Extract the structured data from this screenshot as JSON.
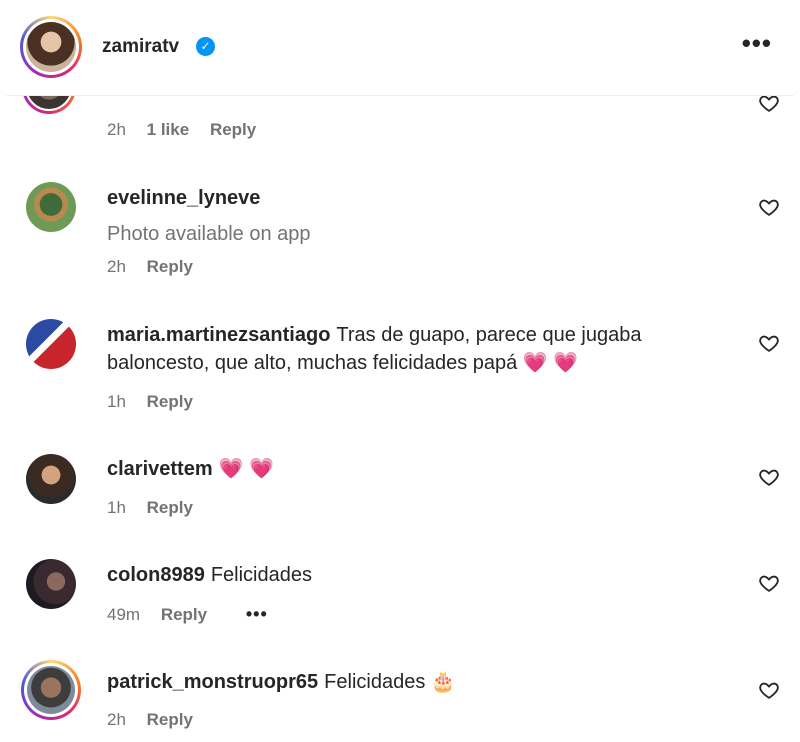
{
  "header": {
    "username": "zamiratv",
    "verified_mark": "✓",
    "more_label": "•••"
  },
  "partial_comment": {
    "time": "2h",
    "likes": "1 like",
    "reply": "Reply"
  },
  "comments": [
    {
      "username": "evelinne_lyneve",
      "text": "Photo available on app",
      "time": "2h",
      "reply": "Reply"
    },
    {
      "username": "maria.martinezsantiago",
      "text": "Tras de guapo, parece que jugaba baloncesto, que alto, muchas felicidades papá",
      "emoji": "💗 💗",
      "time": "1h",
      "reply": "Reply"
    },
    {
      "username": "clarivettem",
      "text": "",
      "emoji": "💗 💗",
      "time": "1h",
      "reply": "Reply"
    },
    {
      "username": "colon8989",
      "text": "Felicidades",
      "time": "49m",
      "reply": "Reply",
      "more_label": "•••"
    },
    {
      "username": "patrick_monstruopr65",
      "text": "Felicidades",
      "emoji": "🎂",
      "time": "2h",
      "reply": "Reply"
    }
  ],
  "icons": {
    "heart": "heart-outline-icon",
    "more": "more-horizontal-icon",
    "verified": "verified-badge-icon"
  }
}
